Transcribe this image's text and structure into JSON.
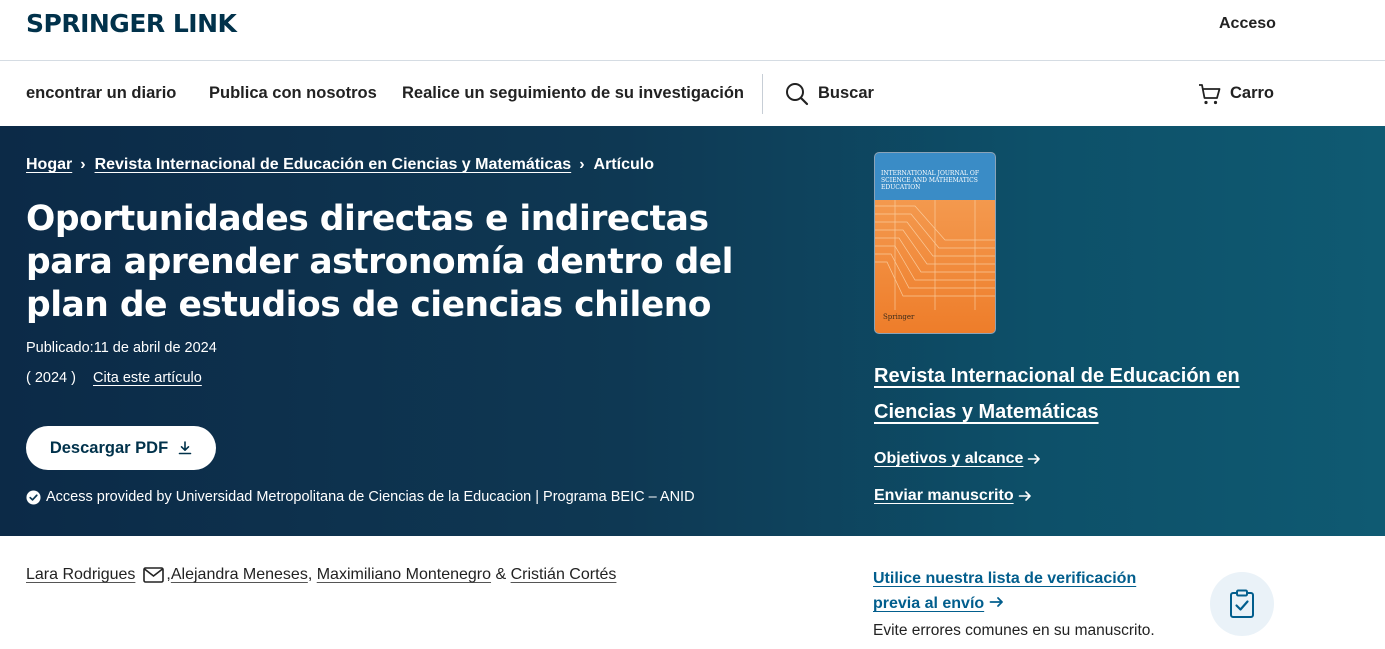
{
  "header": {
    "logo": "SPRINGER LINK",
    "login": "Acceso"
  },
  "nav": {
    "find_journal": "encontrar un diario",
    "publish": "Publica con nosotros",
    "track": "Realice un seguimiento de su investigación",
    "search": "Buscar",
    "cart": "Carro"
  },
  "breadcrumb": {
    "home": "Hogar",
    "journal": "Revista Internacional de Educación en Ciencias y Matemáticas",
    "current": "Artículo"
  },
  "article": {
    "title": "Oportunidades directas e indirectas para aprender astronomía dentro del plan de estudios de ciencias chileno",
    "published": "Publicado:11 de abril de 2024",
    "year": "( 2024 )",
    "cite": "Cita este artículo",
    "download_pdf": "Descargar PDF",
    "access": "Access provided by Universidad Metropolitana de Ciencias de la Educacion | Programa BEIC – ANID"
  },
  "cover": {
    "text": "INTERNATIONAL JOURNAL OF SCIENCE AND MATHEMATICS EDUCATION",
    "publisher": "Springer"
  },
  "journal_panel": {
    "title": "Revista Internacional de Educación en Ciencias y Matemáticas",
    "aims": "Objetivos y alcance",
    "submit": "Enviar manuscrito"
  },
  "authors": {
    "a1": "Lara Rodrigues",
    "a2": "Alejandra Meneses",
    "a3": "Maximiliano Montenegro",
    "amp": "&",
    "a4": "Cristián Cortés"
  },
  "checklist": {
    "title": "Utilice nuestra lista de verificación previa al envío",
    "subtitle": "Evite errores comunes en su manuscrito."
  },
  "colors": {
    "brand": "#01324b",
    "hero_bg": "#0e3853",
    "link_blue": "#025e8d"
  }
}
